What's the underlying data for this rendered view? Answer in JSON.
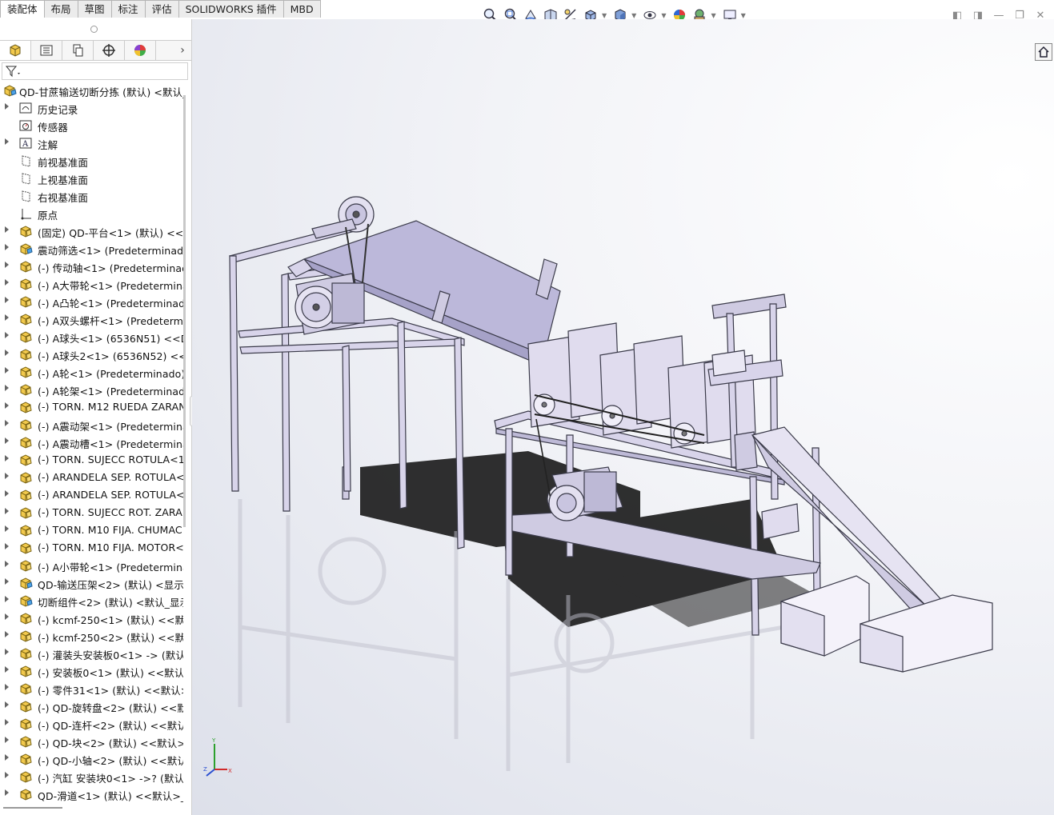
{
  "tabs": [
    "装配体",
    "布局",
    "草图",
    "标注",
    "评估",
    "SOLIDWORKS 插件",
    "MBD"
  ],
  "view_toolbar_icons": [
    "zoom-to-fit-icon",
    "zoom-area-icon",
    "previous-view-icon",
    "section-view-icon",
    "dynamic-annotation-icon",
    "view-orientation-icon",
    "display-style-icon",
    "hide-show-icon",
    "edit-appearance-icon",
    "apply-scene-icon",
    "view-settings-icon"
  ],
  "window_controls": [
    "tile-left-icon",
    "tile-right-icon",
    "minimize-icon",
    "restore-icon",
    "close-icon"
  ],
  "feature_manager_tabs": [
    "featuremanager-icon",
    "propertymanager-icon",
    "configurationmanager-icon",
    "dimxpert-icon",
    "displaymanager-icon"
  ],
  "tree": {
    "root": "QD-甘蔗输送切断分拣 (默认) <默认_",
    "items": [
      {
        "label": "历史记录",
        "icon": "history-icon",
        "expandable": true
      },
      {
        "label": "传感器",
        "icon": "sensor-icon",
        "expandable": false
      },
      {
        "label": "注解",
        "icon": "annotation-icon",
        "expandable": true
      },
      {
        "label": "前视基准面",
        "icon": "plane-icon",
        "expandable": false
      },
      {
        "label": "上视基准面",
        "icon": "plane-icon",
        "expandable": false
      },
      {
        "label": "右视基准面",
        "icon": "plane-icon",
        "expandable": false
      },
      {
        "label": "原点",
        "icon": "origin-icon",
        "expandable": false
      },
      {
        "label": "(固定) QD-平台<1> (默认) <<默",
        "icon": "part-icon",
        "expandable": true
      },
      {
        "label": "震动筛选<1> (Predeterminado",
        "icon": "assembly-icon",
        "expandable": true
      },
      {
        "label": "(-) 传动轴<1> (Predeterminado",
        "icon": "part-icon",
        "expandable": true
      },
      {
        "label": "(-) A大带轮<1> (Predetermina",
        "icon": "part-icon",
        "expandable": true
      },
      {
        "label": "(-) A凸轮<1> (Predeterminado",
        "icon": "part-icon",
        "expandable": true
      },
      {
        "label": "(-) A双头螺杆<1> (Predetermin",
        "icon": "part-icon",
        "expandable": true
      },
      {
        "label": "(-) A球头<1> (6536N51) <<De",
        "icon": "part-icon",
        "expandable": true
      },
      {
        "label": "(-) A球头2<1> (6536N52) <<D",
        "icon": "part-icon",
        "expandable": true
      },
      {
        "label": "(-) A轮<1> (Predeterminado)",
        "icon": "part-icon",
        "expandable": true
      },
      {
        "label": "(-) A轮架<1> (Predeterminado",
        "icon": "part-icon",
        "expandable": true
      },
      {
        "label": "(-) TORN. M12 RUEDA  ZARAN",
        "icon": "part-icon",
        "expandable": true
      },
      {
        "label": "(-) A震动架<1> (Predetermina",
        "icon": "part-icon",
        "expandable": true
      },
      {
        "label": "(-) A震动槽<1> (Predetermina",
        "icon": "part-icon",
        "expandable": true
      },
      {
        "label": "(-) TORN. SUJECC ROTULA<1:",
        "icon": "part-icon",
        "expandable": true
      },
      {
        "label": "(-) ARANDELA SEP. ROTULA<1",
        "icon": "part-icon",
        "expandable": true
      },
      {
        "label": "(-) ARANDELA SEP. ROTULA<2",
        "icon": "part-icon",
        "expandable": true
      },
      {
        "label": "(-) TORN. SUJECC ROT. ZARAI",
        "icon": "part-icon",
        "expandable": true
      },
      {
        "label": "(-) TORN. M10 FIJA. CHUMAC",
        "icon": "part-icon",
        "expandable": true
      },
      {
        "label": "(-) TORN. M10 FIJA. MOTOR<",
        "icon": "part-icon",
        "expandable": true
      },
      {
        "label": "(-) A小带轮<1> (Predetermina",
        "icon": "part-icon",
        "expandable": true
      },
      {
        "label": "QD-输送压架<2> (默认) <显示状",
        "icon": "assembly-icon",
        "expandable": true
      },
      {
        "label": "切断组件<2> (默认) <默认_显示",
        "icon": "assembly-icon",
        "expandable": true
      },
      {
        "label": "(-) kcmf-250<1> (默认) <<默认",
        "icon": "part-icon",
        "expandable": true
      },
      {
        "label": "(-) kcmf-250<2> (默认) <<默认",
        "icon": "part-icon",
        "expandable": true
      },
      {
        "label": "(-) 灌装头安装板0<1> -> (默认)",
        "icon": "part-icon",
        "expandable": true
      },
      {
        "label": "(-) 安装板0<1> (默认) <<默认>",
        "icon": "part-icon",
        "expandable": true
      },
      {
        "label": "(-) 零件31<1> (默认) <<默认>_",
        "icon": "part-icon",
        "expandable": true
      },
      {
        "label": "(-) QD-旋转盘<2> (默认) <<默",
        "icon": "part-icon",
        "expandable": true
      },
      {
        "label": "(-) QD-连杆<2> (默认) <<默认",
        "icon": "part-icon",
        "expandable": true
      },
      {
        "label": "(-) QD-块<2> (默认) <<默认>_",
        "icon": "part-icon",
        "expandable": true
      },
      {
        "label": "(-) QD-小轴<2> (默认) <<默认",
        "icon": "part-icon",
        "expandable": true
      },
      {
        "label": "(-) 汽缸 安装块0<1> ->? (默认)",
        "icon": "part-icon",
        "expandable": true
      },
      {
        "label": "QD-滑道<1> (默认) <<默认>_显",
        "icon": "part-icon",
        "expandable": true
      }
    ]
  },
  "viewport": {
    "home_icon": "home-view-icon",
    "triad_labels": {
      "x": "X",
      "y": "Y",
      "z": "Z"
    },
    "colors": {
      "metal": "#d8d4ea",
      "metal_edge": "#3b3b4a",
      "shadow": "#1a1a1a"
    }
  }
}
